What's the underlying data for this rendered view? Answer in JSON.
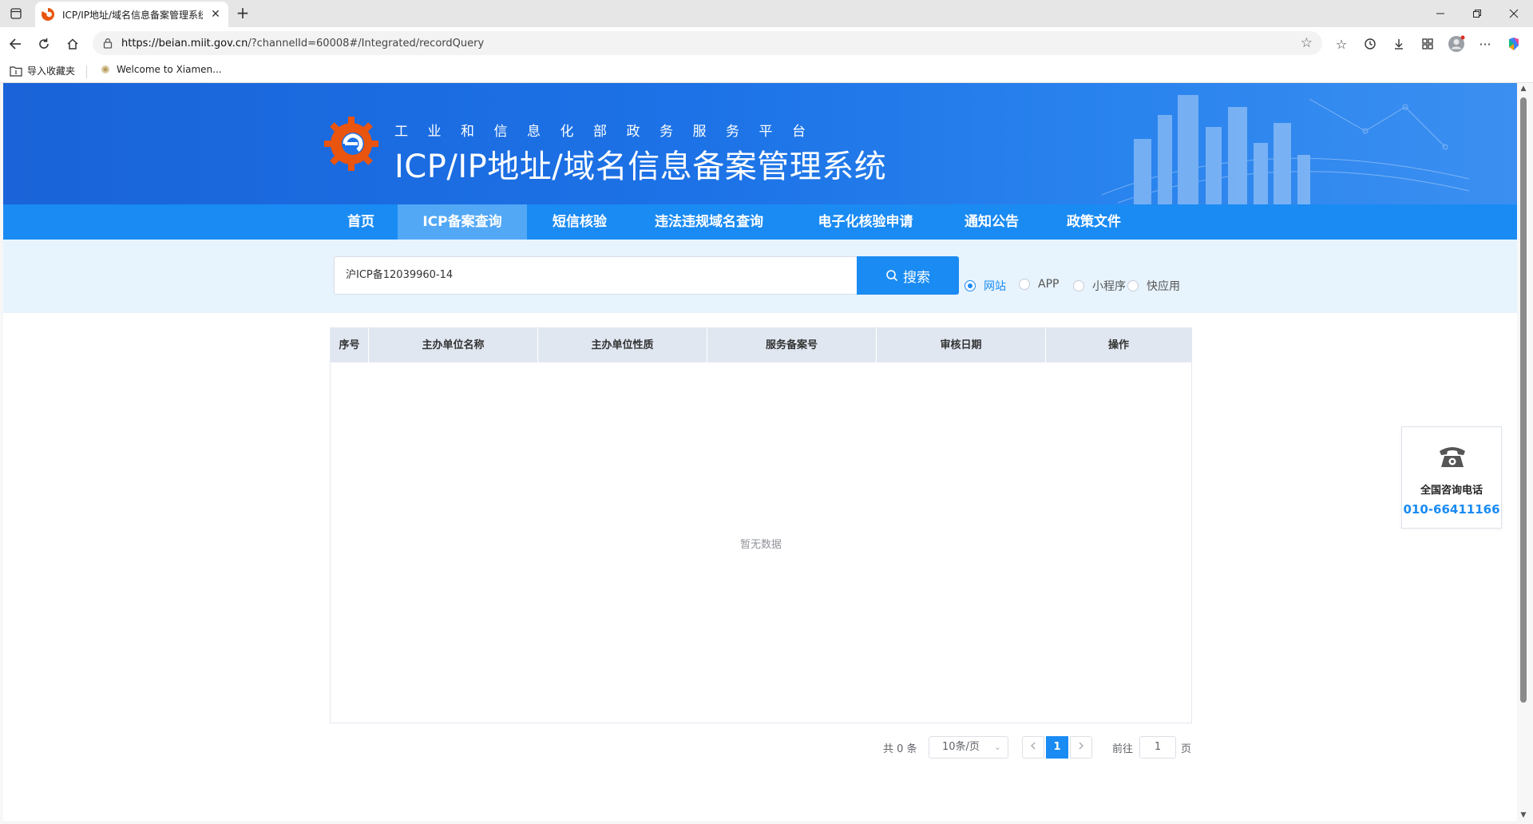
{
  "browser": {
    "tab_title": "ICP/IP地址/域名信息备案管理系统",
    "tab_close": "✕",
    "new_tab": "+",
    "url_host": "https://beian.miit.gov.cn",
    "url_path": "/?channelId=60008#/Integrated/recordQuery",
    "favorites": [
      {
        "label": "导入收藏夹",
        "icon": "folder-import-icon"
      },
      {
        "label": "Welcome to Xiamen...",
        "icon": "site-favicon"
      }
    ]
  },
  "banner": {
    "subtitle": "工业和信息化部政务服务平台",
    "title": "ICP/IP地址/域名信息备案管理系统",
    "colors": {
      "banner": "#1c72e6",
      "nav": "#1a8bf3",
      "nav_active": "#52a8f5",
      "logo": "#e9540f"
    }
  },
  "nav": {
    "items": [
      {
        "label": "首页",
        "active": false
      },
      {
        "label": "ICP备案查询",
        "active": true
      },
      {
        "label": "短信核验",
        "active": false
      },
      {
        "label": "违法违规域名查询",
        "active": false
      },
      {
        "label": "电子化核验申请",
        "active": false
      },
      {
        "label": "通知公告",
        "active": false
      },
      {
        "label": "政策文件",
        "active": false
      }
    ]
  },
  "search": {
    "value": "沪ICP备12039960-14",
    "button_label": "搜索",
    "types": [
      {
        "label": "网站",
        "selected": true
      },
      {
        "label": "APP",
        "selected": false
      },
      {
        "label": "小程序",
        "selected": false
      },
      {
        "label": "快应用",
        "selected": false
      }
    ]
  },
  "table": {
    "columns": [
      "序号",
      "主办单位名称",
      "主办单位性质",
      "服务备案号",
      "审核日期",
      "操作"
    ],
    "rows": [],
    "empty_text": "暂无数据"
  },
  "pagination": {
    "total_text": "共 0 条",
    "page_size": "10条/页",
    "current_page": "1",
    "goto_prefix": "前往",
    "goto_value": "1",
    "goto_suffix": "页"
  },
  "hotline": {
    "label": "全国咨询电话",
    "number": "010-66411166"
  }
}
